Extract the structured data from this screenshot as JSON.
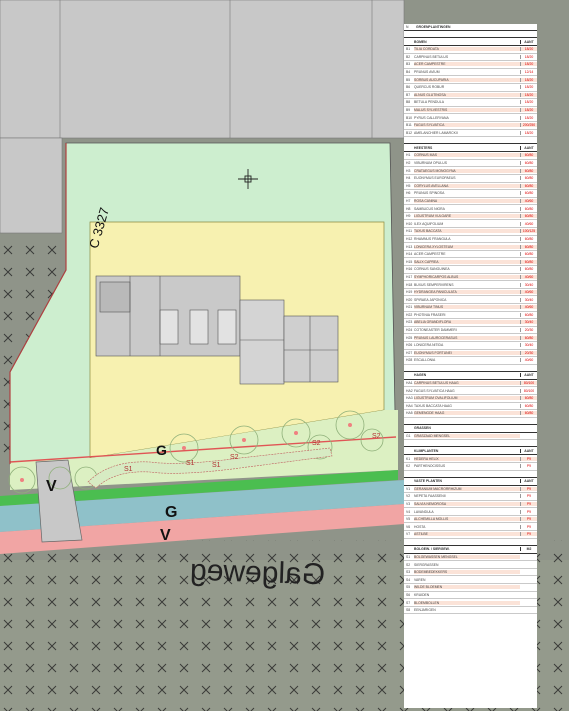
{
  "map": {
    "road_name": "Galgeweg",
    "parcel_label": "C 3327",
    "zone_letter_g": "G",
    "zone_letter_v": "V",
    "green_label": "G",
    "strip_v_label": "V",
    "cursor_icon": "crosshair-cursor-icon",
    "colors": {
      "aerial": "#8f9489",
      "green_zone": "#cdeecf",
      "yellow_zone": "#f7f1b0",
      "light_green_strip": "#dcf0c2",
      "blue_strip": "#8fc1c9",
      "pink_strip": "#f1a5a4",
      "green_line": "#44c24a",
      "grey_parcels": "#c8c8c8"
    },
    "plant_labels": [
      "S1",
      "S1",
      "S2",
      "S2",
      "S2",
      "S1"
    ]
  },
  "legend": {
    "top_code": "N",
    "top_title": "GROENPLANTINGEN",
    "sections": [
      {
        "title": "BOMEN",
        "qty_header": "AANT",
        "rows": [
          {
            "code": "B1",
            "name": "TILIA CORDATA",
            "qty": "18/20"
          },
          {
            "code": "B2",
            "name": "CARPINUS BETULUS",
            "qty": "18/20"
          },
          {
            "code": "B3",
            "name": "ACER CAMPESTRE",
            "qty": "18/20"
          },
          {
            "code": "B4",
            "name": "PRUNUS AVIUM",
            "qty": "12/14"
          },
          {
            "code": "B5",
            "name": "SORBUS AUCUPARIA",
            "qty": "18/20"
          },
          {
            "code": "B6",
            "name": "QUERCUS ROBUR",
            "qty": "18/20"
          },
          {
            "code": "B7",
            "name": "ALNUS GLUTINOSA",
            "qty": "18/20"
          },
          {
            "code": "B8",
            "name": "BETULA PENDULA",
            "qty": "18/20"
          },
          {
            "code": "B9",
            "name": "MALUS SYLVESTRIS",
            "qty": "18/20"
          },
          {
            "code": "B10",
            "name": "PYRUS CALLERYANA",
            "qty": "18/20"
          },
          {
            "code": "B11",
            "name": "FAGUS SYLVATICA",
            "qty": "200/250"
          },
          {
            "code": "B12",
            "name": "AMELANCHIER LAMARCKII",
            "qty": "18/20"
          }
        ]
      },
      {
        "title": "HEESTERS",
        "qty_header": "AANT",
        "rows": [
          {
            "code": "H1",
            "name": "CORNUS MAS",
            "qty": "60/80"
          },
          {
            "code": "H2",
            "name": "VIBURNUM OPULUS",
            "qty": "60/80"
          },
          {
            "code": "H3",
            "name": "CRATAEGUS MONOGYNA",
            "qty": "60/80"
          },
          {
            "code": "H4",
            "name": "EUONYMUS EUROPAEUS",
            "qty": "60/80"
          },
          {
            "code": "H5",
            "name": "CORYLUS AVELLANA",
            "qty": "60/80"
          },
          {
            "code": "H6",
            "name": "PRUNUS SPINOSA",
            "qty": "60/80"
          },
          {
            "code": "H7",
            "name": "ROSA CANINA",
            "qty": "40/60"
          },
          {
            "code": "H8",
            "name": "SAMBUCUS NIGRA",
            "qty": "60/80"
          },
          {
            "code": "H9",
            "name": "LIGUSTRUM VULGARE",
            "qty": "60/80"
          },
          {
            "code": "H10",
            "name": "ILEX AQUIFOLIUM",
            "qty": "40/60"
          },
          {
            "code": "H11",
            "name": "TAXUS BACCATA",
            "qty": "100/125"
          },
          {
            "code": "H12",
            "name": "RHAMNUS FRANGULA",
            "qty": "60/80"
          },
          {
            "code": "H13",
            "name": "LONICERA XYLOSTEUM",
            "qty": "60/80"
          },
          {
            "code": "H14",
            "name": "ACER CAMPESTRE",
            "qty": "60/80"
          },
          {
            "code": "H15",
            "name": "SALIX CAPREA",
            "qty": "60/80"
          },
          {
            "code": "H16",
            "name": "CORNUS SANGUINEA",
            "qty": "60/80"
          },
          {
            "code": "H17",
            "name": "SYMPHORICARPOS ALBUS",
            "qty": "40/60"
          },
          {
            "code": "H18",
            "name": "BUXUS SEMPERVIRENS",
            "qty": "30/40"
          },
          {
            "code": "H19",
            "name": "HYDRANGEA PANICULATA",
            "qty": "40/60"
          },
          {
            "code": "H20",
            "name": "SPIRAEA JAPONICA",
            "qty": "30/40"
          },
          {
            "code": "H21",
            "name": "VIBURNUM TINUS",
            "qty": "40/60"
          },
          {
            "code": "H22",
            "name": "PHOTINIA FRASERI",
            "qty": "60/80"
          },
          {
            "code": "H23",
            "name": "ABELIA GRANDIFLORA",
            "qty": "30/40"
          },
          {
            "code": "H24",
            "name": "COTONEASTER DAMMERI",
            "qty": "20/30"
          },
          {
            "code": "H25",
            "name": "PRUNUS LAUROCERASUS",
            "qty": "60/80"
          },
          {
            "code": "H26",
            "name": "LONICERA NITIDA",
            "qty": "30/40"
          },
          {
            "code": "H27",
            "name": "EUONYMUS FORTUNEI",
            "qty": "20/30"
          },
          {
            "code": "H28",
            "name": "ESCALLONIA",
            "qty": "40/60"
          }
        ]
      },
      {
        "title": "HAGEN",
        "qty_header": "AANT",
        "rows": [
          {
            "code": "HA1",
            "name": "CARPINUS BETULUS HAAG",
            "qty": "80/100"
          },
          {
            "code": "HA2",
            "name": "FAGUS SYLVATICA HAAG",
            "qty": "80/100"
          },
          {
            "code": "HA3",
            "name": "LIGUSTRUM OVALIFOLIUM",
            "qty": "60/80"
          },
          {
            "code": "HA4",
            "name": "TAXUS BACCATA HAAG",
            "qty": "60/80"
          },
          {
            "code": "HA5",
            "name": "GEMENGDE HAAG",
            "qty": "60/80"
          }
        ]
      },
      {
        "title": "GRASSEN",
        "qty_header": "",
        "rows": [
          {
            "code": "G1",
            "name": "GRASZAAD MENGSEL",
            "qty": ""
          }
        ]
      },
      {
        "title": "KLIMPLANTEN",
        "qty_header": "AANT",
        "rows": [
          {
            "code": "K1",
            "name": "HEDERA HELIX",
            "qty": "P9"
          },
          {
            "code": "K2",
            "name": "PARTHENOCISSUS",
            "qty": "P9"
          }
        ]
      },
      {
        "title": "VASTE PLANTEN",
        "qty_header": "AANT",
        "rows": [
          {
            "code": "V1",
            "name": "GERANIUM MACRORRHIZUM",
            "qty": "P9"
          },
          {
            "code": "V2",
            "name": "NEPETA FAASSENII",
            "qty": "P9"
          },
          {
            "code": "V3",
            "name": "SALVIA NEMOROSA",
            "qty": "P9"
          },
          {
            "code": "V4",
            "name": "LAVANDULA",
            "qty": "P9"
          },
          {
            "code": "V5",
            "name": "ALCHEMILLA MOLLIS",
            "qty": "P9"
          },
          {
            "code": "V6",
            "name": "HOSTA",
            "qty": "P9"
          },
          {
            "code": "V7",
            "name": "ASTILBE",
            "qty": "P9"
          }
        ]
      },
      {
        "title": "BOLGEW. / SIERGEW.",
        "qty_header": "M2",
        "rows": [
          {
            "code": "S1",
            "name": "BOLGEWASSEN MENGSEL",
            "qty": ""
          },
          {
            "code": "S2",
            "name": "SIERGRASSEN",
            "qty": ""
          },
          {
            "code": "S3",
            "name": "BODEMBEDEKKERS",
            "qty": ""
          },
          {
            "code": "S4",
            "name": "VAREN",
            "qty": ""
          },
          {
            "code": "S5",
            "name": "WILDE BLOEMEN",
            "qty": ""
          },
          {
            "code": "S6",
            "name": "KRUIDEN",
            "qty": ""
          },
          {
            "code": "S7",
            "name": "BLOEMBOLLEN",
            "qty": ""
          },
          {
            "code": "S8",
            "name": "EENJARIGEN",
            "qty": ""
          }
        ]
      }
    ]
  }
}
